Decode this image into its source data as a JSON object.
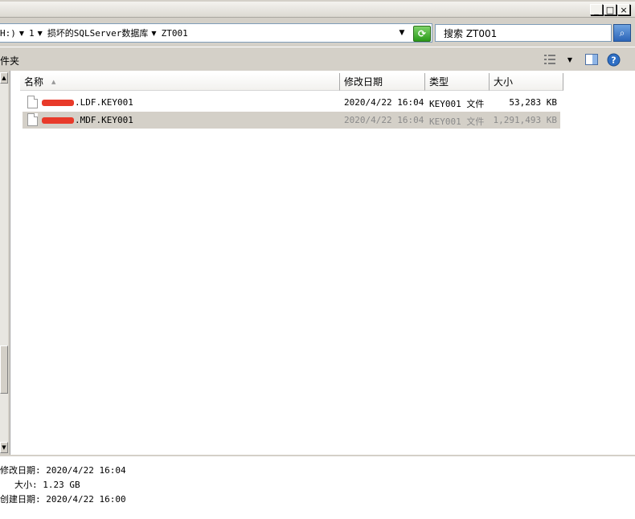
{
  "window": {
    "minimize_glyph": "_",
    "maximize_glyph": "□",
    "close_glyph": "×"
  },
  "address": {
    "crumbs": [
      "H:)",
      "1",
      "损坏的SQLServer数据库",
      "ZT001"
    ],
    "search_placeholder": "搜索 ZT001"
  },
  "toolbar": {
    "folder_label": "件夹"
  },
  "columns": {
    "name": "名称",
    "modified": "修改日期",
    "type": "类型",
    "size": "大小"
  },
  "files": [
    {
      "name_suffix": ".LDF.KEY001",
      "modified": "2020/4/22 16:04",
      "type": "KEY001 文件",
      "size": "53,283 KB",
      "selected": false
    },
    {
      "name_suffix": ".MDF.KEY001",
      "modified": "2020/4/22 16:04",
      "type": "KEY001 文件",
      "size": "1,291,493 KB",
      "selected": true
    }
  ],
  "details": {
    "modified_label": "修改日期:",
    "modified_value": "2020/4/22 16:04",
    "size_label": "大小:",
    "size_value": "1.23 GB",
    "created_label": "创建日期:",
    "created_value": "2020/4/22 16:00"
  },
  "colors": {
    "chrome": "#d4d0c8",
    "selection": "#d4d0c8",
    "redaction": "#e83a2a"
  }
}
